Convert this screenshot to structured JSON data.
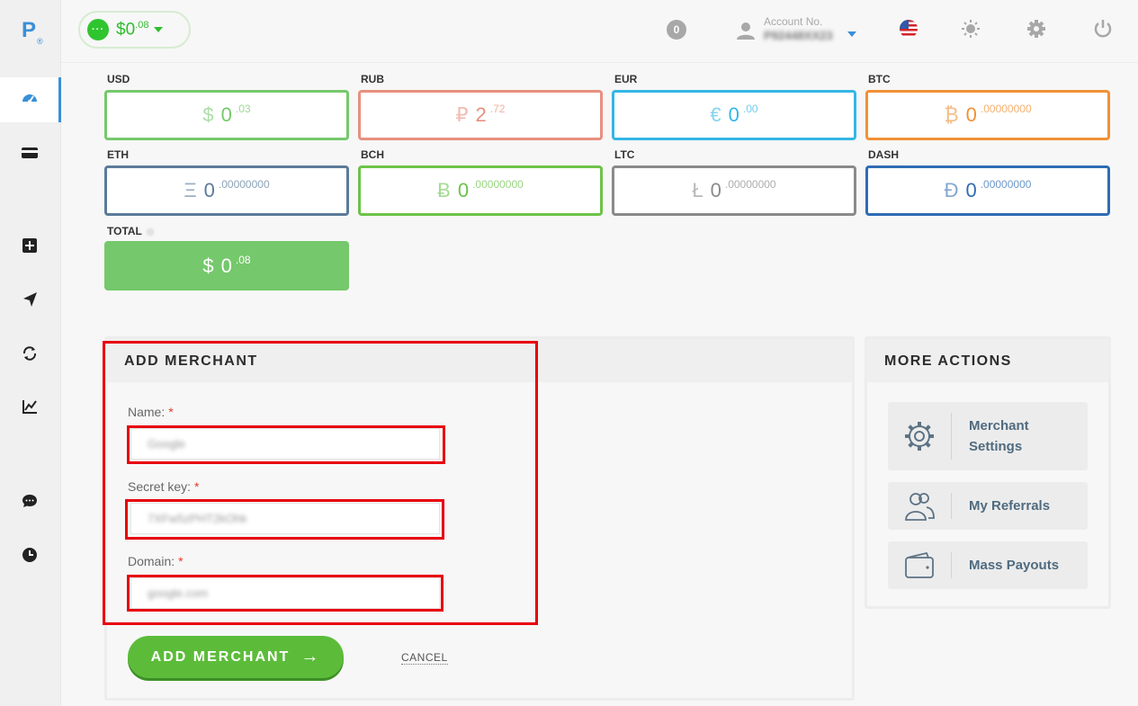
{
  "app": {
    "logo": "P",
    "logo_mark": "®"
  },
  "header": {
    "balance_main": "$0",
    "balance_cents": ".08",
    "balance_dots": "···",
    "notifications": "0",
    "account_label": "Account No.",
    "account_value": "P92448XX23"
  },
  "sidebar": {
    "items": [
      {
        "name": "dashboard-icon"
      },
      {
        "name": "wallet-card-icon"
      },
      {
        "name": "add-funds-icon"
      },
      {
        "name": "send-icon"
      },
      {
        "name": "exchange-icon"
      },
      {
        "name": "stats-chart-icon"
      },
      {
        "name": "chat-icon"
      },
      {
        "name": "history-clock-icon"
      }
    ]
  },
  "currencies": [
    {
      "label": "USD",
      "symbol": "$",
      "int": "0",
      "dec": ".03",
      "color": "#75c86b"
    },
    {
      "label": "RUB",
      "symbol": "₽",
      "int": "2",
      "dec": ".72",
      "color": "#e8907d"
    },
    {
      "label": "EUR",
      "symbol": "€",
      "int": "0",
      "dec": ".00",
      "color": "#35b6e6"
    },
    {
      "label": "BTC",
      "symbol": "₿",
      "int": "0",
      "dec": ".00000000",
      "color": "#f19137"
    },
    {
      "label": "ETH",
      "symbol": "Ξ",
      "int": "0",
      "dec": ".00000000",
      "color": "#5b7b9a"
    },
    {
      "label": "BCH",
      "symbol": "Ƀ",
      "int": "0",
      "dec": ".00000000",
      "color": "#6cc34a"
    },
    {
      "label": "LTC",
      "symbol": "Ł",
      "int": "0",
      "dec": ".00000000",
      "color": "#8a8a8a"
    },
    {
      "label": "DASH",
      "symbol": "Đ",
      "int": "0",
      "dec": ".00000000",
      "color": "#2f6cb4"
    }
  ],
  "total": {
    "label": "TOTAL",
    "symbol": "$",
    "int": "0",
    "dec": ".08"
  },
  "merchant_form": {
    "title": "ADD MERCHANT",
    "name_label": "Name:",
    "name_value": "Google",
    "secret_label": "Secret key:",
    "secret_value": "7XFw5zPHT2kOhk",
    "domain_label": "Domain:",
    "domain_value": "google.com",
    "required_mark": "*",
    "submit_label": "ADD MERCHANT",
    "submit_arrow": "→",
    "cancel_label": "CANCEL"
  },
  "more_actions": {
    "title": "MORE ACTIONS",
    "items": [
      {
        "label_line1": "Merchant",
        "label_line2": "Settings",
        "icon": "gear-icon"
      },
      {
        "label_line1": "My Referrals",
        "icon": "users-icon"
      },
      {
        "label_line1": "Mass Payouts",
        "icon": "wallet-icon"
      }
    ]
  },
  "colors": {
    "accent": "#3a8fd8",
    "green": "#5cbc3a",
    "highlight": "#e8000e"
  }
}
